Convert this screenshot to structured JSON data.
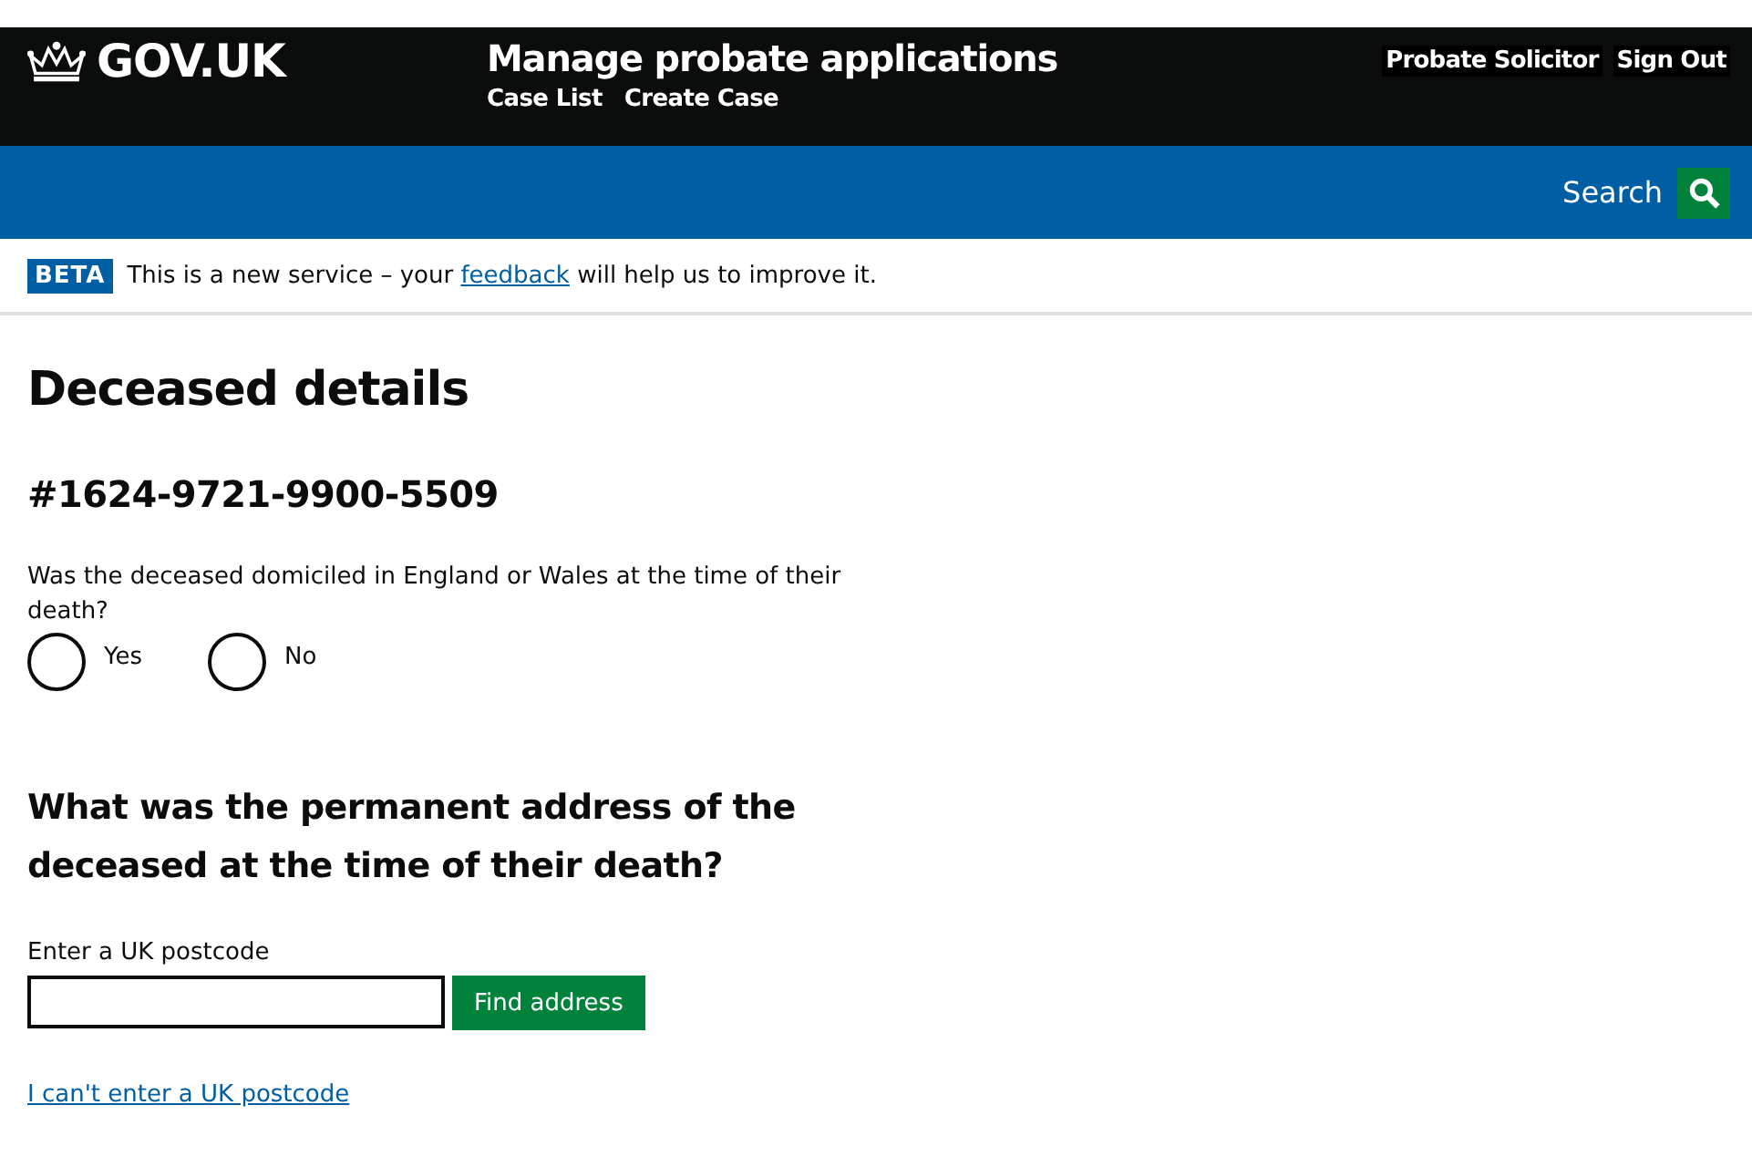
{
  "header": {
    "logo": "GOV.UK",
    "service": "Manage probate applications",
    "nav": [
      "Case List",
      "Create Case"
    ],
    "user": "Probate Solicitor",
    "sign_out": "Sign Out"
  },
  "search": {
    "label": "Search"
  },
  "banner": {
    "tag": "BETA",
    "text_before": "This is a new service – your",
    "link": "feedback",
    "text_after": "will help us to improve it."
  },
  "page_title": "Deceased details",
  "case_number": "#1624-9721-9900-5509",
  "question": "Was the deceased domiciled in England or Wales at the time of their death?",
  "options": [
    {
      "label": "Yes",
      "selected": false
    },
    {
      "label": "No",
      "selected": false
    }
  ],
  "address_heading": "What was the permanent address of the deceased at the time of their death?",
  "postcode": {
    "label": "Enter a UK postcode",
    "button": "Find address"
  },
  "alt_link": "I can't enter a UK postcode"
}
